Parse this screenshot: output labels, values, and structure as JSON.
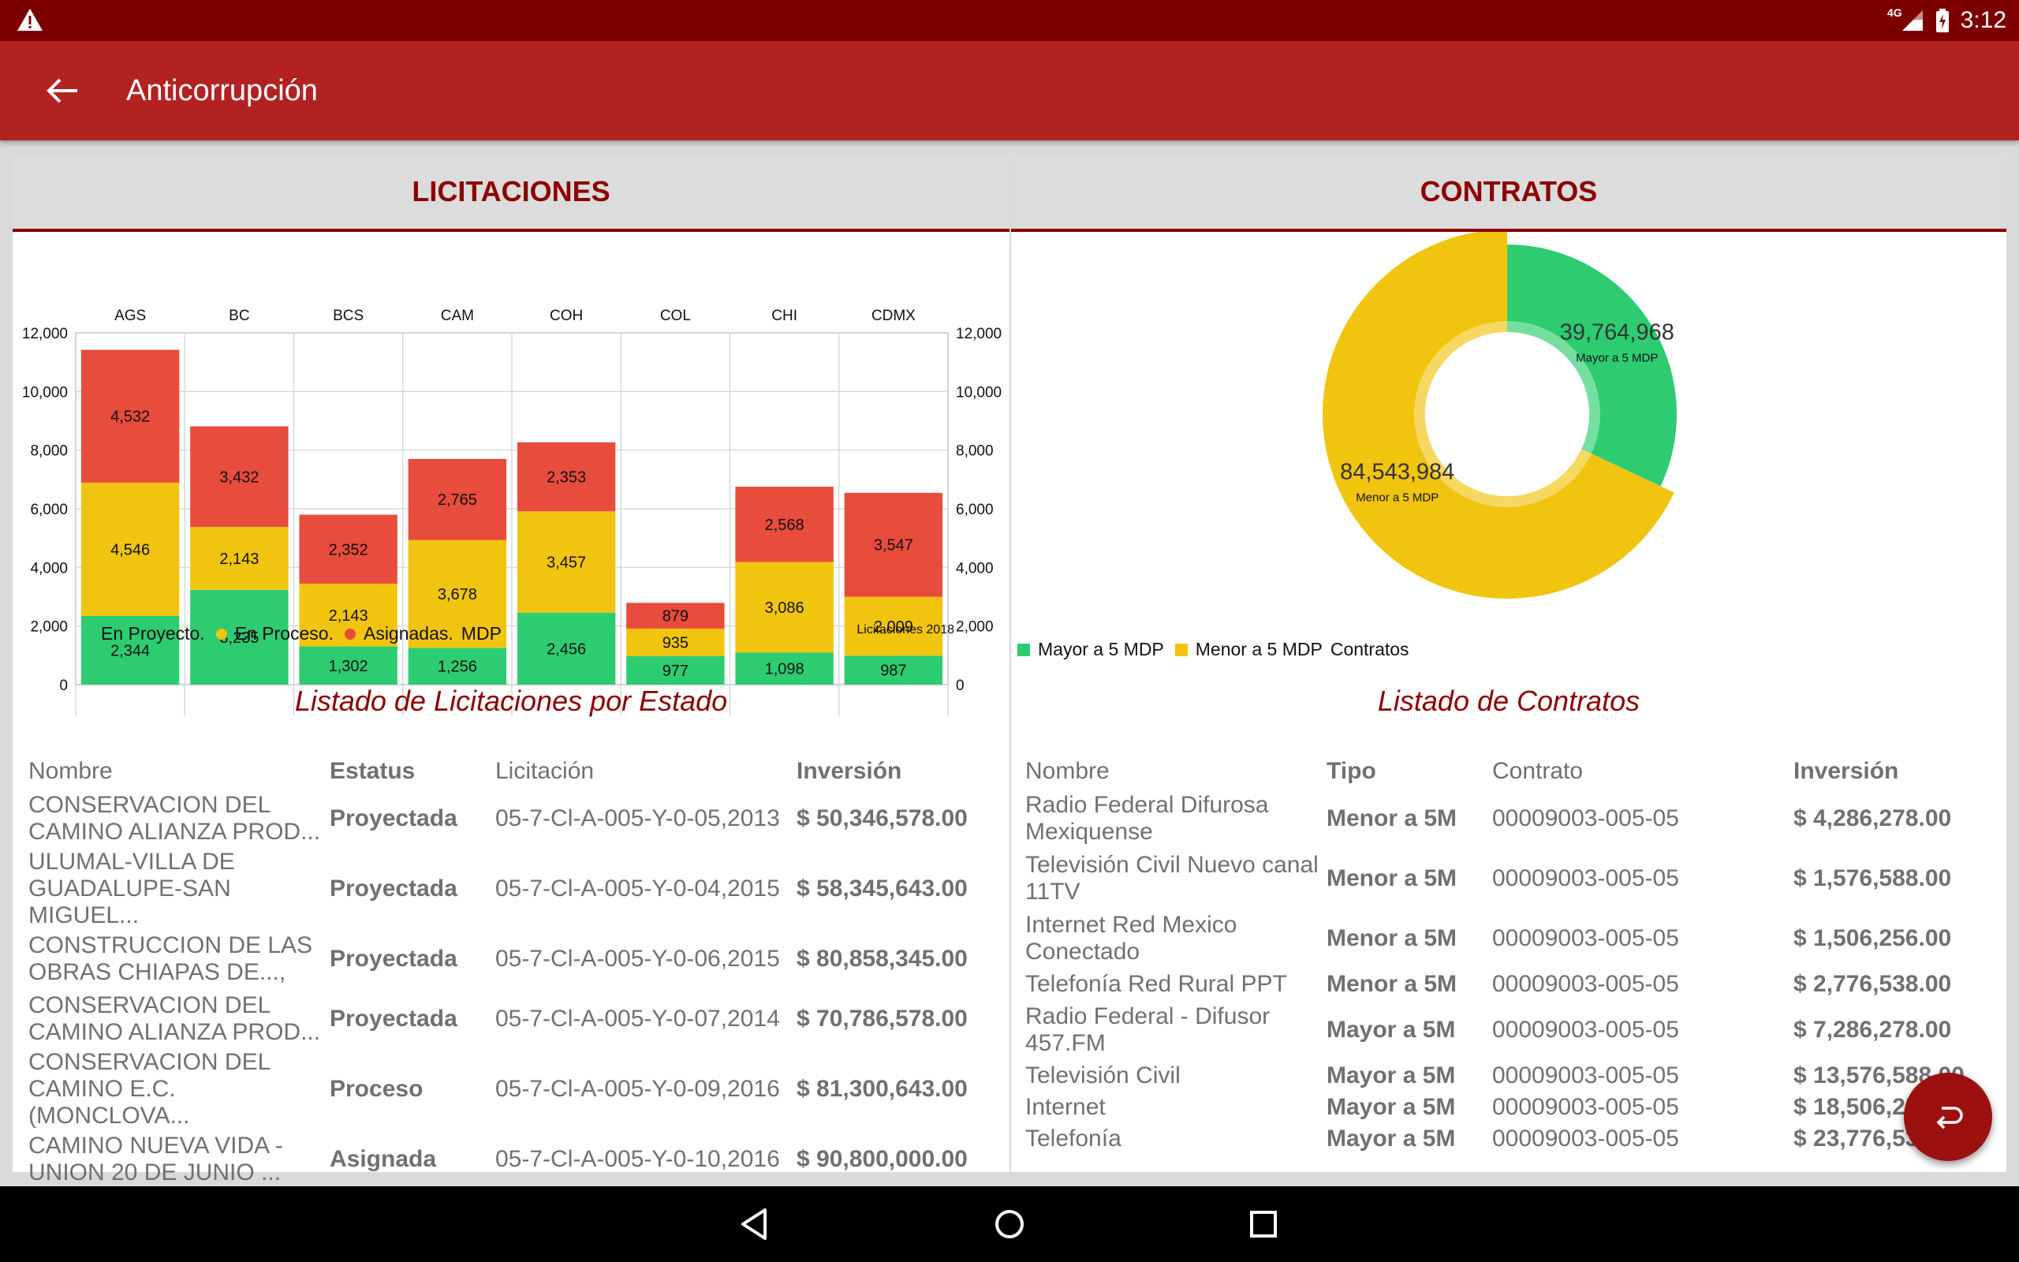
{
  "status_bar": {
    "time": "3:12",
    "network": "4G"
  },
  "app_bar": {
    "title": "Anticorrupción"
  },
  "licitaciones": {
    "header": "LICITACIONES",
    "list_title": "Listado de Licitaciones por Estado",
    "columns": [
      "Nombre",
      "Estatus",
      "Licitación",
      "Inversión"
    ],
    "rows": [
      {
        "nombre": "CONSERVACION DEL CAMINO ALIANZA PROD...",
        "estatus": "Proyectada",
        "licitacion": "05-7-Cl-A-005-Y-0-05,2013",
        "inversion": "$ 50,346,578.00"
      },
      {
        "nombre": "ULUMAL-VILLA DE GUADALUPE-SAN MIGUEL...",
        "estatus": "Proyectada",
        "licitacion": "05-7-Cl-A-005-Y-0-04,2015",
        "inversion": "$ 58,345,643.00"
      },
      {
        "nombre": "CONSTRUCCION DE LAS OBRAS CHIAPAS DE...,",
        "estatus": "Proyectada",
        "licitacion": "05-7-Cl-A-005-Y-0-06,2015",
        "inversion": "$ 80,858,345.00"
      },
      {
        "nombre": "CONSERVACION DEL CAMINO ALIANZA PROD...",
        "estatus": "Proyectada",
        "licitacion": "05-7-Cl-A-005-Y-0-07,2014",
        "inversion": "$ 70,786,578.00"
      },
      {
        "nombre": "CONSERVACION DEL CAMINO E.C. (MONCLOVA...",
        "estatus": "Proceso",
        "licitacion": "05-7-Cl-A-005-Y-0-09,2016",
        "inversion": "$ 81,300,643.00"
      },
      {
        "nombre": "CAMINO NUEVA VIDA - UNION 20 DE JUNIO ...",
        "estatus": "Asignada",
        "licitacion": "05-7-Cl-A-005-Y-0-10,2016",
        "inversion": "$ 90,800,000.00"
      }
    ]
  },
  "contratos": {
    "header": "CONTRATOS",
    "list_title": "Listado de Contratos",
    "columns": [
      "Nombre",
      "Tipo",
      "Contrato",
      "Inversión"
    ],
    "rows": [
      {
        "nombre": "Radio Federal Difurosa Mexiquense",
        "tipo": "Menor a 5M",
        "contrato": "00009003-005-05",
        "inversion": "$ 4,286,278.00"
      },
      {
        "nombre": "Televisión Civil Nuevo canal 11TV",
        "tipo": "Menor a 5M",
        "contrato": "00009003-005-05",
        "inversion": "$ 1,576,588.00"
      },
      {
        "nombre": "Internet Red Mexico Conectado",
        "tipo": "Menor a 5M",
        "contrato": "00009003-005-05",
        "inversion": "$ 1,506,256.00"
      },
      {
        "nombre": "Telefonía Red Rural PPT",
        "tipo": "Menor a 5M",
        "contrato": "00009003-005-05",
        "inversion": "$ 2,776,538.00"
      },
      {
        "nombre": "Radio Federal - Difusor 457.FM",
        "tipo": "Mayor a 5M",
        "contrato": "00009003-005-05",
        "inversion": "$ 7,286,278.00"
      },
      {
        "nombre": "Televisión Civil",
        "tipo": "Mayor a 5M",
        "contrato": "00009003-005-05",
        "inversion": "$ 13,576,588.00"
      },
      {
        "nombre": "Internet",
        "tipo": "Mayor a 5M",
        "contrato": "00009003-005-05",
        "inversion": "$ 18,506,256.00"
      },
      {
        "nombre": "Telefonía",
        "tipo": "Mayor a 5M",
        "contrato": "00009003-005-05",
        "inversion": "$ 23,776,538.00"
      }
    ]
  },
  "icons": {
    "warning": "warning-icon",
    "back": "arrow-back-icon",
    "fab": "undo-icon",
    "nav": [
      "nav-back-icon",
      "nav-home-icon",
      "nav-recents-icon"
    ]
  },
  "chart_data": [
    {
      "type": "bar",
      "stacked": true,
      "categories": [
        "AGS",
        "BC",
        "BCS",
        "CAM",
        "COH",
        "COL",
        "CHI",
        "CDMX"
      ],
      "series": [
        {
          "name": "En Proyecto.",
          "color": "#2ecc71",
          "values": [
            2344,
            3235,
            1302,
            1256,
            2456,
            977,
            1098,
            987
          ]
        },
        {
          "name": "En Proceso.",
          "color": "#f1c40f",
          "values": [
            4546,
            2143,
            2143,
            3678,
            3457,
            935,
            3086,
            2009
          ]
        },
        {
          "name": "Asignadas.",
          "color": "#e74c3c",
          "values": [
            4532,
            3432,
            2352,
            2765,
            2353,
            879,
            2568,
            3547
          ]
        }
      ],
      "legend_suffix": "MDP",
      "description": "Licitaciones 2018",
      "ylim": [
        0,
        12000
      ],
      "y_ticks": [
        0,
        2000,
        4000,
        6000,
        8000,
        10000,
        12000
      ],
      "y_tick_labels": [
        "0",
        "2,000",
        "4,000",
        "6,000",
        "8,000",
        "10,000",
        "12,000"
      ],
      "x_axis_position": "top",
      "grid": true,
      "legend_position": "bottom-left"
    },
    {
      "type": "pie",
      "donut": true,
      "slices": [
        {
          "label": "Mayor a 5 MDP",
          "value": 39764968,
          "display": "39,764,968",
          "color": "#2ecc71"
        },
        {
          "label": "Menor a 5 MDP",
          "value": 84543984,
          "display": "84,543,984",
          "color": "#f1c40f"
        }
      ],
      "description": "Contratos",
      "legend_position": "bottom-left"
    }
  ]
}
